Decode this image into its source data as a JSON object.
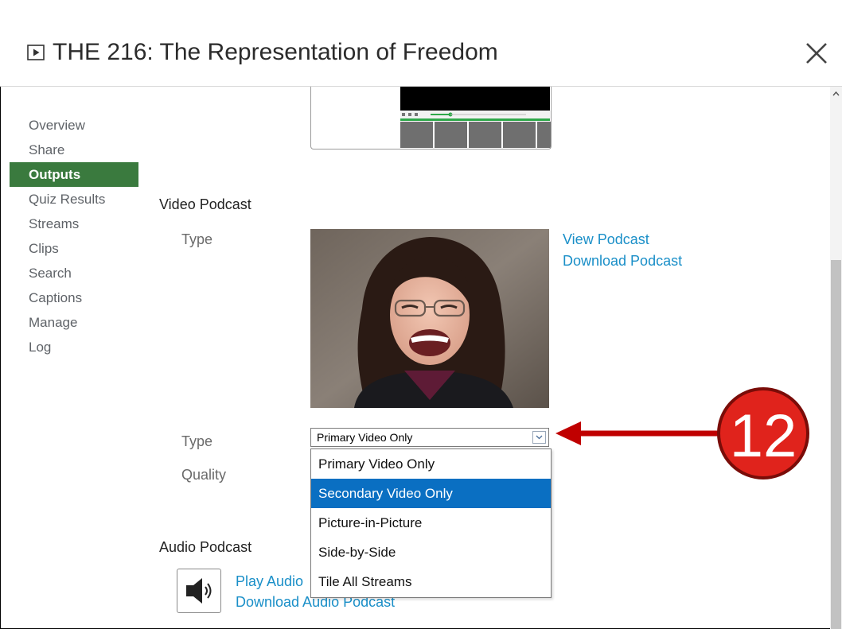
{
  "window": {
    "title": "THE 216: The Representation of Freedom",
    "title_icon": "play-icon",
    "close_icon": "close-icon"
  },
  "sidebar": {
    "items": [
      {
        "label": "Overview",
        "active": false
      },
      {
        "label": "Share",
        "active": false
      },
      {
        "label": "Outputs",
        "active": true
      },
      {
        "label": "Quiz Results",
        "active": false
      },
      {
        "label": "Streams",
        "active": false
      },
      {
        "label": "Clips",
        "active": false
      },
      {
        "label": "Search",
        "active": false
      },
      {
        "label": "Captions",
        "active": false
      },
      {
        "label": "Manage",
        "active": false
      },
      {
        "label": "Log",
        "active": false
      }
    ],
    "active_color": "#3a7a3e"
  },
  "video_podcast": {
    "section_title": "Video Podcast",
    "type_label": "Type",
    "view_link": "View Podcast",
    "download_link": "Download Podcast",
    "type_select_label": "Type",
    "quality_label": "Quality",
    "type_select": {
      "value": "Primary Video Only",
      "options": [
        "Primary Video Only",
        "Secondary Video Only",
        "Picture-in-Picture",
        "Side-by-Side",
        "Tile All Streams"
      ],
      "highlighted": "Secondary Video Only"
    }
  },
  "audio_podcast": {
    "section_title": "Audio Podcast",
    "play_link": "Play Audio",
    "download_link": "Download Audio Podcast",
    "icon": "speaker-icon"
  },
  "annotation": {
    "number": "12",
    "badge_color": "#e0231c",
    "arrow_color": "#c00000"
  },
  "colors": {
    "link": "#1a8fc8",
    "highlight": "#0a6fc2"
  }
}
